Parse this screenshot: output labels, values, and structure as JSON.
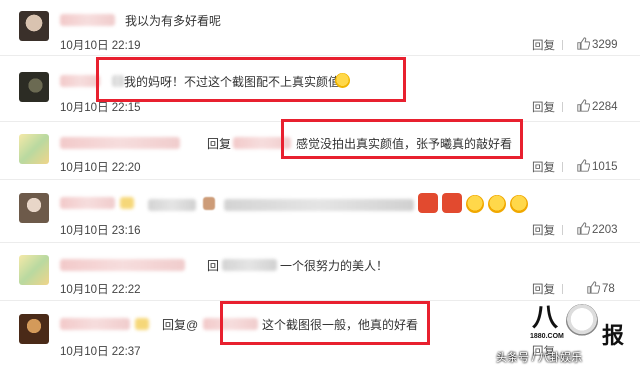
{
  "comments": [
    {
      "text": "我以为有多好看呢",
      "time": "10月10日 22:19",
      "reply": "回复",
      "likes": "3299"
    },
    {
      "text": "我的妈呀！不过这个截图配不上真实颜值",
      "time": "10月10日 22:15",
      "reply": "回复",
      "likes": "2284"
    },
    {
      "prefix": "回复",
      "text": "感觉没拍出真实颜值，张予曦真的敲好看",
      "time": "10月10日 22:20",
      "reply": "回复",
      "likes": "1015"
    },
    {
      "time": "10月10日 23:16",
      "reply": "回复",
      "likes": "2203"
    },
    {
      "prefix": "回",
      "text": "一个很努力的美人！",
      "time": "10月10日 22:22",
      "reply": "回复",
      "likes": "78"
    },
    {
      "prefix": "回复@",
      "text": "这个截图很一般，他真的好看",
      "time": "10月10日 22:37",
      "reply": "回复"
    }
  ],
  "watermark": {
    "logo_main": "八",
    "logo_sub": "1880.COM",
    "logo_right": "报",
    "caption": "头条号 / 八卦娱乐"
  },
  "colors": {
    "highlight": "#e8202f",
    "accent": "#f08a00"
  }
}
